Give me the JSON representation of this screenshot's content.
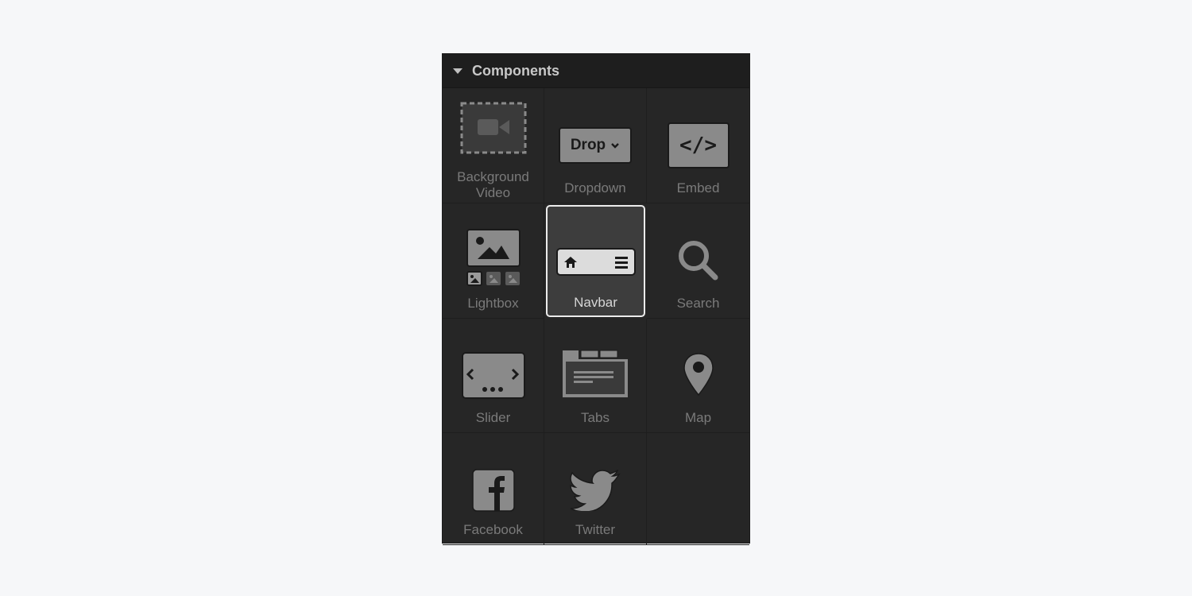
{
  "panel": {
    "title": "Components",
    "collapse_icon": "caret-down-icon",
    "selected_item": "Navbar",
    "items": [
      {
        "label": "Background Video",
        "icon": "background-video-icon"
      },
      {
        "label": "Dropdown",
        "icon": "dropdown-icon",
        "icon_text": "Drop"
      },
      {
        "label": "Embed",
        "icon": "embed-code-icon",
        "icon_text": "</>"
      },
      {
        "label": "Lightbox",
        "icon": "lightbox-icon"
      },
      {
        "label": "Navbar",
        "icon": "navbar-icon"
      },
      {
        "label": "Search",
        "icon": "search-icon"
      },
      {
        "label": "Slider",
        "icon": "slider-icon"
      },
      {
        "label": "Tabs",
        "icon": "tabs-icon"
      },
      {
        "label": "Map",
        "icon": "map-pin-icon"
      },
      {
        "label": "Facebook",
        "icon": "facebook-icon"
      },
      {
        "label": "Twitter",
        "icon": "twitter-icon"
      }
    ]
  },
  "colors": {
    "page_bg": "#f6f7f9",
    "panel_bg": "#262626",
    "header_bg": "#1e1e1e",
    "icon_fill": "#8a8a8a",
    "label_color": "#7a7a7a",
    "selected_bg": "#3d3d3d",
    "selected_border": "#ececec"
  }
}
